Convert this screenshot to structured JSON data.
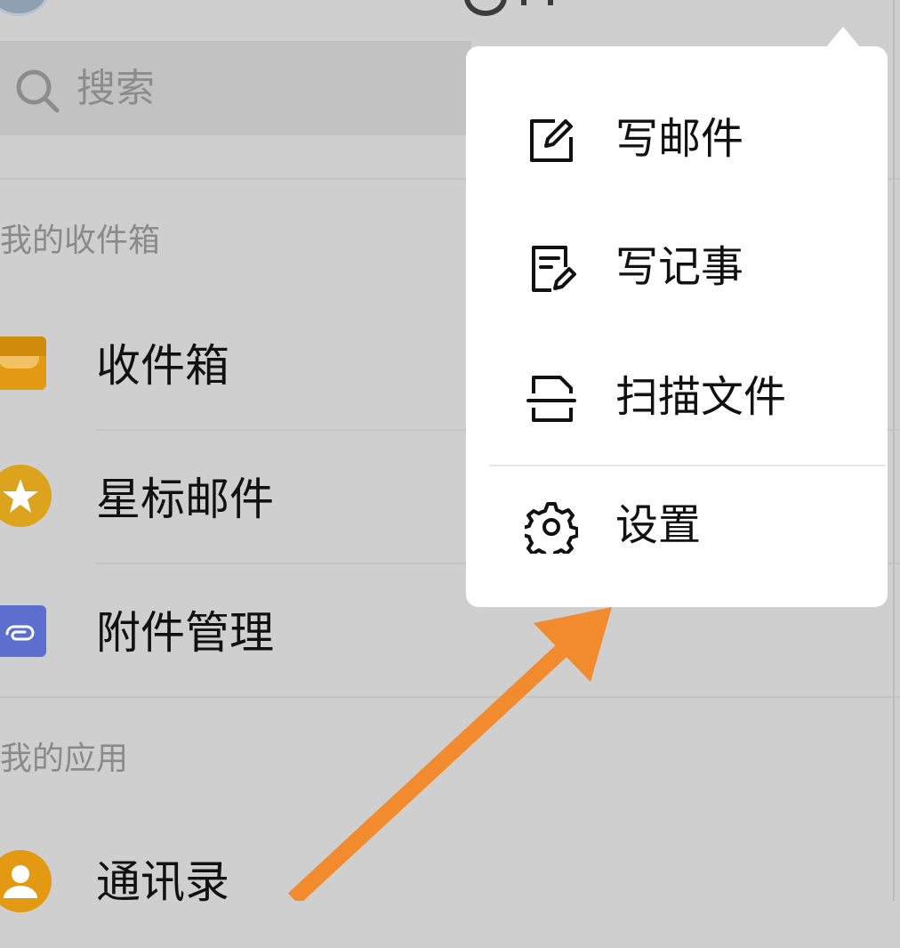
{
  "search": {
    "placeholder": "搜索"
  },
  "sections": {
    "my_inbox": "我的收件箱",
    "my_apps": "我的应用"
  },
  "list": {
    "inbox": "收件箱",
    "starred": "星标邮件",
    "attachments": "附件管理",
    "contacts": "通讯录"
  },
  "popup": {
    "items": [
      {
        "label": "写邮件",
        "icon": "compose-icon"
      },
      {
        "label": "写记事",
        "icon": "note-icon"
      },
      {
        "label": "扫描文件",
        "icon": "scan-icon"
      },
      {
        "label": "设置",
        "icon": "gear-icon"
      }
    ]
  },
  "colors": {
    "overlay_bg": "#cfcfcf",
    "arrow": "#f28a2e",
    "popup_bg": "#ffffff",
    "inbox_icon": "#e39a12",
    "star_icon": "#dca31c",
    "attach_icon": "#5c6fcf"
  }
}
